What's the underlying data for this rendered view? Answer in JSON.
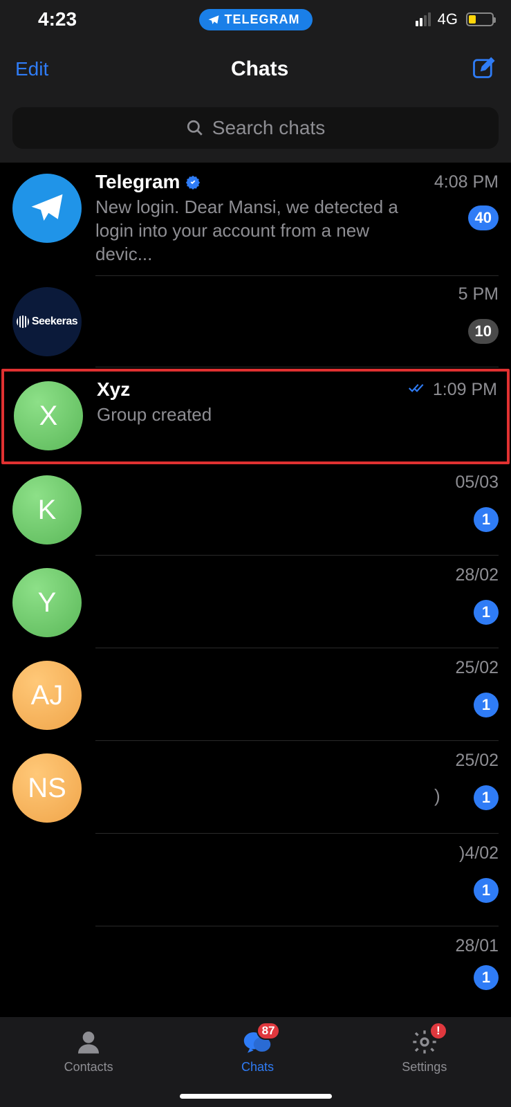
{
  "status": {
    "time": "4:23",
    "network": "4G"
  },
  "pill": {
    "label": "TELEGRAM"
  },
  "header": {
    "edit": "Edit",
    "title": "Chats"
  },
  "search": {
    "placeholder": "Search chats"
  },
  "chats": [
    {
      "name": "Telegram",
      "verified": true,
      "time": "4:08 PM",
      "preview": "New login. Dear Mansi, we detected a login into your account from a new devic...",
      "badge": "40",
      "badgeColor": "blue",
      "avatarType": "telegram"
    },
    {
      "name": "",
      "time": "5 PM",
      "preview": "",
      "badge": "10",
      "badgeColor": "gray",
      "seekeras": "Seekeras"
    },
    {
      "name": "Xyz",
      "time": "1:09 PM",
      "preview": "Group created",
      "readChecks": true,
      "initial": "X",
      "avatarColor": "green",
      "highlighted": true
    },
    {
      "name": "",
      "time": "05/03",
      "badge": "1",
      "badgeColor": "blue",
      "initial": "K",
      "avatarColor": "green"
    },
    {
      "name": "",
      "time": "28/02",
      "badge": "1",
      "badgeColor": "blue",
      "initial": "Y",
      "avatarColor": "green"
    },
    {
      "name": "",
      "time": "25/02",
      "badge": "1",
      "badgeColor": "blue",
      "initial": "AJ",
      "avatarColor": "orange"
    },
    {
      "name": "",
      "time": "25/02",
      "badge": "1",
      "badgeColor": "blue",
      "initial": "NS",
      "avatarColor": "orange",
      "fragment": ")"
    },
    {
      "name": "",
      "time": ")4/02",
      "badge": "1",
      "badgeColor": "blue",
      "noAvatar": true
    },
    {
      "name": "",
      "time": "28/01",
      "badge": "1",
      "badgeColor": "blue",
      "noAvatar": true
    }
  ],
  "tabs": {
    "contacts": "Contacts",
    "chats": "Chats",
    "chatsBadge": "87",
    "settings": "Settings",
    "settingsBadge": "!"
  }
}
